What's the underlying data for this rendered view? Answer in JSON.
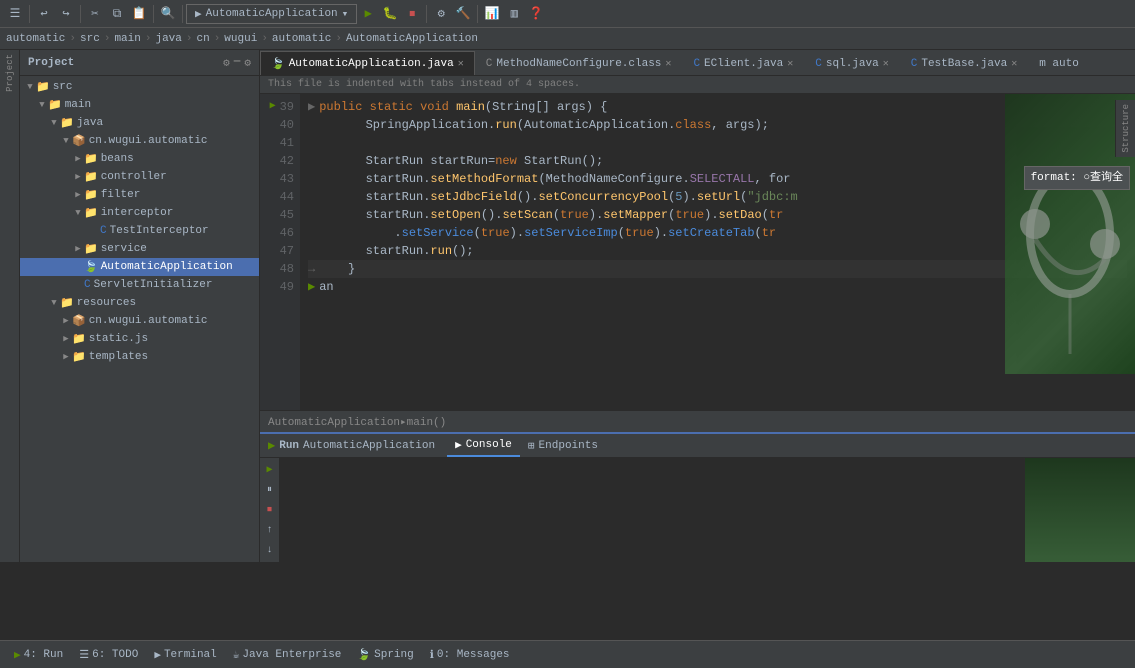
{
  "toolbar": {
    "run_config": "AutomaticApplication",
    "buttons": [
      "⟳",
      "↩",
      "↪",
      "✂",
      "⧉",
      "⧉",
      "↶",
      "↷",
      "🔍",
      "🔍",
      "⟹",
      "≡",
      "≡",
      "⌃",
      "▶",
      "⏸",
      "⏹",
      "⟫",
      "⚙",
      "🔧",
      "🔨",
      "⊞",
      "⟳",
      "🔍",
      "↕",
      "📊",
      "⬜",
      "❓",
      "≡"
    ]
  },
  "breadcrumb": {
    "items": [
      "automatic",
      "src",
      "main",
      "java",
      "cn",
      "wugui",
      "automatic",
      "AutomaticApplication"
    ]
  },
  "tabs": [
    {
      "label": "AutomaticApplication.java",
      "active": true,
      "closable": true
    },
    {
      "label": "MethodNameConfigure.class",
      "active": false,
      "closable": true
    },
    {
      "label": "EClient.java",
      "active": false,
      "closable": true
    },
    {
      "label": "sql.java",
      "active": false,
      "closable": true
    },
    {
      "label": "TestBase.java",
      "active": false,
      "closable": true
    },
    {
      "label": "m auto",
      "active": false,
      "closable": false
    }
  ],
  "file_info": {
    "message": "This file is indented with tabs instead of 4 spaces."
  },
  "sidebar": {
    "title": "Project",
    "tree": [
      {
        "indent": 0,
        "type": "folder",
        "open": true,
        "label": "src"
      },
      {
        "indent": 1,
        "type": "folder",
        "open": true,
        "label": "main"
      },
      {
        "indent": 2,
        "type": "folder",
        "open": true,
        "label": "java"
      },
      {
        "indent": 3,
        "type": "folder",
        "open": true,
        "label": "cn.wugui.automatic"
      },
      {
        "indent": 4,
        "type": "folder",
        "open": true,
        "label": "beans"
      },
      {
        "indent": 4,
        "type": "folder",
        "open": false,
        "label": "controller"
      },
      {
        "indent": 4,
        "type": "folder",
        "open": false,
        "label": "filter"
      },
      {
        "indent": 4,
        "type": "folder",
        "open": true,
        "label": "interceptor"
      },
      {
        "indent": 5,
        "type": "java",
        "label": "TestInterceptor"
      },
      {
        "indent": 4,
        "type": "folder",
        "open": false,
        "label": "service"
      },
      {
        "indent": 4,
        "type": "java-app",
        "label": "AutomaticApplication"
      },
      {
        "indent": 4,
        "type": "java",
        "label": "ServletInitializer"
      },
      {
        "indent": 2,
        "type": "folder",
        "open": true,
        "label": "resources"
      },
      {
        "indent": 3,
        "type": "folder",
        "open": false,
        "label": "cn.wugui.automatic"
      },
      {
        "indent": 3,
        "type": "folder",
        "open": false,
        "label": "static.js"
      },
      {
        "indent": 3,
        "type": "folder",
        "open": false,
        "label": "templates"
      }
    ]
  },
  "code": {
    "lines": [
      {
        "num": 39,
        "arrow": true,
        "content": "    public static void main(String[] args) {"
      },
      {
        "num": 40,
        "content": "        SpringApplication.run(AutomaticApplication.class, args);"
      },
      {
        "num": 41,
        "content": ""
      },
      {
        "num": 42,
        "content": "        StartRun startRun=new StartRun();"
      },
      {
        "num": 43,
        "content": "        startRun.setMethodFormat(MethodNameConfigure.SELECTALL, for"
      },
      {
        "num": 44,
        "content": "        startRun.setJdbcField().setConcurrencyPool(5).setUrl(\"jdbc:m"
      },
      {
        "num": 45,
        "content": "        startRun.setOpen().setScan(true).setMapper(true).setDao(tr"
      },
      {
        "num": 46,
        "content": "            .setService(true).setServiceImp(true).setCreateTab(tr"
      },
      {
        "num": 47,
        "content": "        startRun.run();"
      },
      {
        "num": 48,
        "content": "    }"
      },
      {
        "num": 49,
        "content": "an"
      }
    ],
    "tooltip": "format: ○查询全"
  },
  "editor_breadcrumb": "AutomaticApplication▸main()",
  "run_panel": {
    "title": "Run",
    "app_name": "AutomaticApplication",
    "tabs": [
      {
        "label": "Console",
        "active": true,
        "icon": "▶"
      },
      {
        "label": "Endpoints",
        "active": false,
        "icon": "⊞"
      }
    ]
  },
  "status_bar": {
    "items": [
      {
        "icon": "▶",
        "label": "4: Run"
      },
      {
        "icon": "☰",
        "label": "6: TODO"
      },
      {
        "icon": "▶",
        "label": "Terminal"
      },
      {
        "icon": "☕",
        "label": "Java Enterprise"
      },
      {
        "icon": "🍃",
        "label": "Spring"
      },
      {
        "icon": "ℹ",
        "label": "0: Messages"
      }
    ]
  }
}
